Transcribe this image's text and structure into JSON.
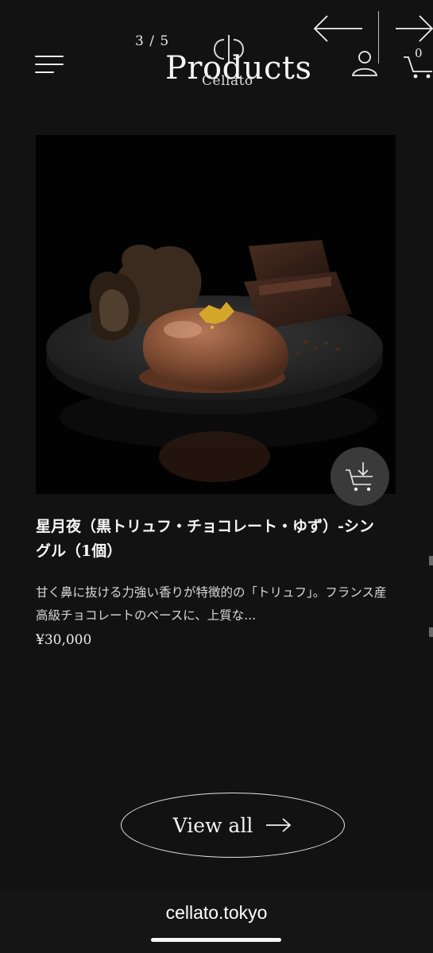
{
  "header": {
    "menu_icon": "hamburger-menu-icon",
    "slide_counter": "3 / 5",
    "logo_text": "Cellato",
    "section_title": "Products",
    "prev_icon": "arrow-left-icon",
    "next_icon": "arrow-right-icon",
    "account_icon": "user-icon",
    "cart_icon": "cart-icon",
    "cart_count": "0"
  },
  "product": {
    "name": "星月夜（黒トリュフ・チョコレート・ゆず）-シングル（1個）",
    "description": "甘く鼻に抜ける力強い香りが特徴的の「トリュフ」。フランス産高級チョコレートのベースに、上質な...",
    "price": "¥30,000",
    "add_to_cart_icon": "cart-download-icon"
  },
  "view_all": {
    "label": "View all",
    "icon": "arrow-right-icon"
  },
  "browser": {
    "url": "cellato.tokyo"
  },
  "colors": {
    "background": "#121212",
    "text": "#f2f2f2",
    "button_bg": "#3a3a3a",
    "gold_leaf": "#d4a72c",
    "chocolate": "#8a5437"
  }
}
